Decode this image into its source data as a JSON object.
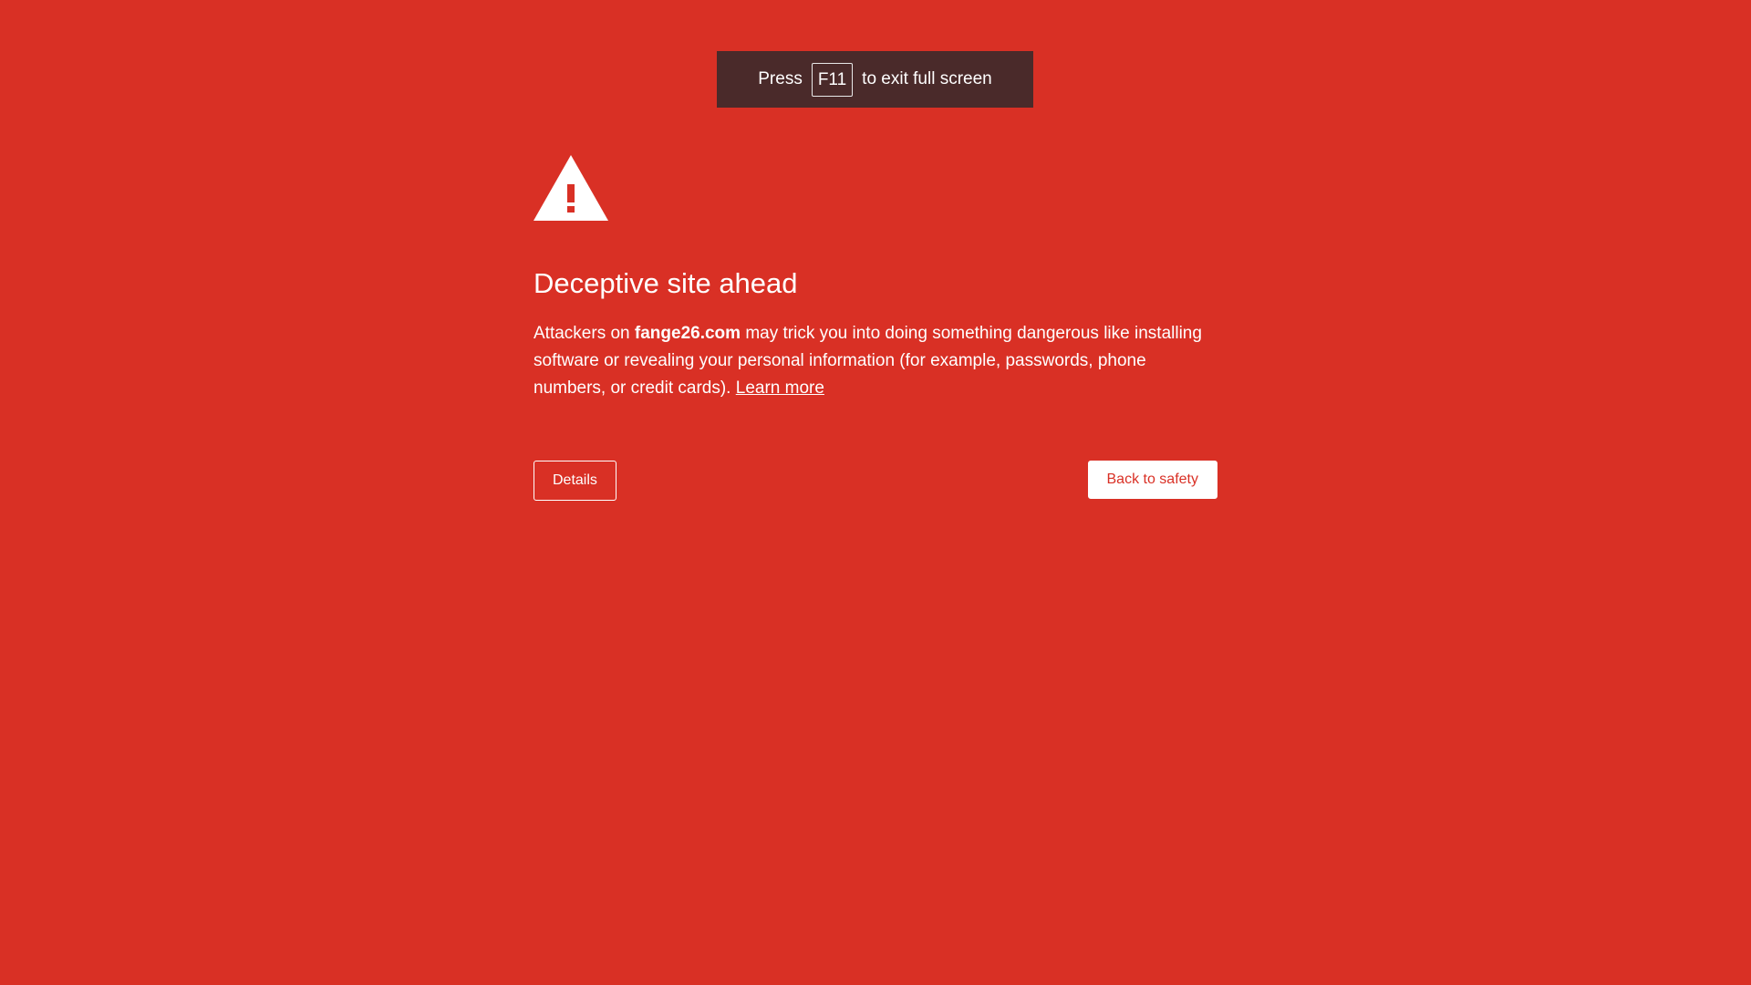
{
  "fullscreen_notice": {
    "prefix": "Press",
    "key": "F11",
    "suffix": "to exit full screen"
  },
  "warning": {
    "icon": "warning-triangle-icon",
    "title": "Deceptive site ahead",
    "body_before": "Attackers on ",
    "domain": "fange26.com",
    "body_after": " may trick you into doing something dangerous like installing software or revealing your personal information (for example, passwords, phone numbers, or credit cards). ",
    "learn_more": "Learn more"
  },
  "buttons": {
    "details": "Details",
    "back_to_safety": "Back to safety"
  },
  "colors": {
    "background": "#d93025",
    "notice_background": "#4a2a2a",
    "text": "#ffffff"
  }
}
